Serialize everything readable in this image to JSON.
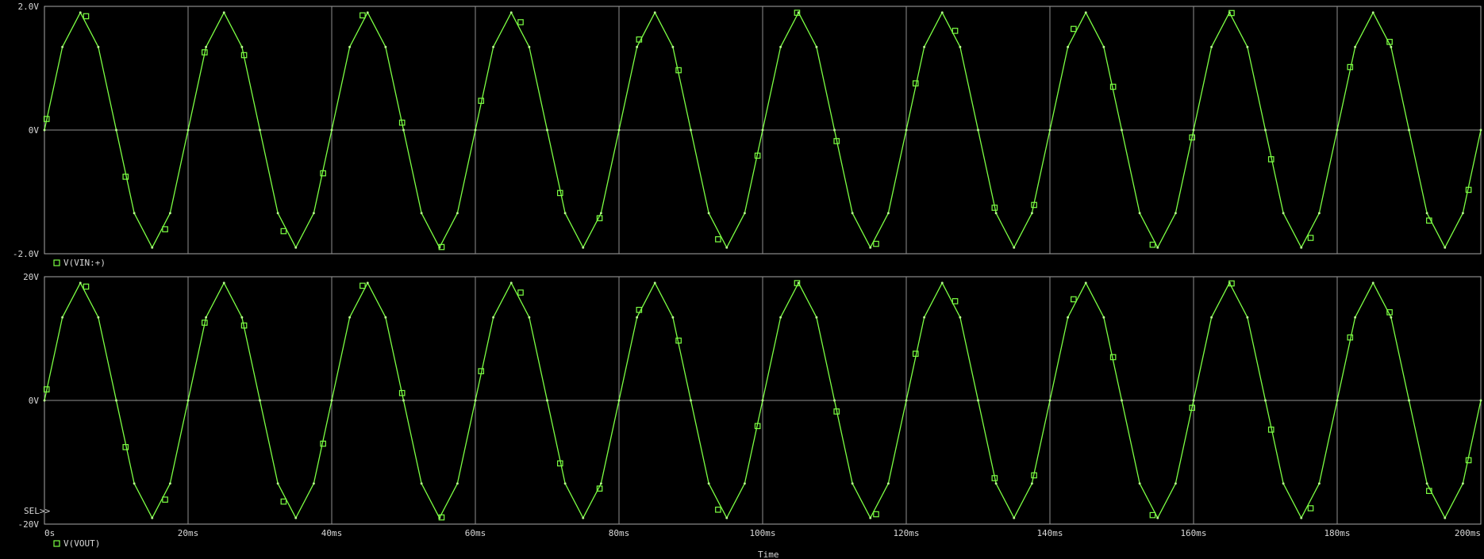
{
  "chart_data": [
    {
      "type": "line",
      "title": "",
      "xlabel": "",
      "ylabel": "",
      "xlim": [
        0,
        200
      ],
      "ylim": [
        -2.0,
        2.0
      ],
      "x_ticks": [
        0,
        20,
        40,
        60,
        80,
        100,
        120,
        140,
        160,
        180,
        200
      ],
      "y_tick_labels": [
        "2.0V",
        "0V",
        "-2.0V"
      ],
      "legend_label": "V(VIN:+)",
      "grid": true,
      "series": [
        {
          "name": "V(VIN:+)",
          "color": "#7cff43",
          "amplitude": 1.9,
          "frequency_hz": 50,
          "phase_deg": 0
        }
      ]
    },
    {
      "type": "line",
      "title": "",
      "xlabel": "Time",
      "ylabel": "",
      "xlim": [
        0,
        200
      ],
      "ylim": [
        -20,
        20
      ],
      "x_ticks": [
        0,
        20,
        40,
        60,
        80,
        100,
        120,
        140,
        160,
        180,
        200
      ],
      "x_tick_labels": [
        "0s",
        "20ms",
        "40ms",
        "60ms",
        "80ms",
        "100ms",
        "120ms",
        "140ms",
        "160ms",
        "180ms",
        "200ms"
      ],
      "y_tick_labels": [
        "20V",
        "0V",
        "-20V"
      ],
      "legend_label": "V(VOUT)",
      "selector_label": "SEL>>",
      "grid": true,
      "series": [
        {
          "name": "V(VOUT)",
          "color": "#7cff43",
          "amplitude": 19,
          "frequency_hz": 50,
          "phase_deg": 0
        }
      ]
    }
  ]
}
